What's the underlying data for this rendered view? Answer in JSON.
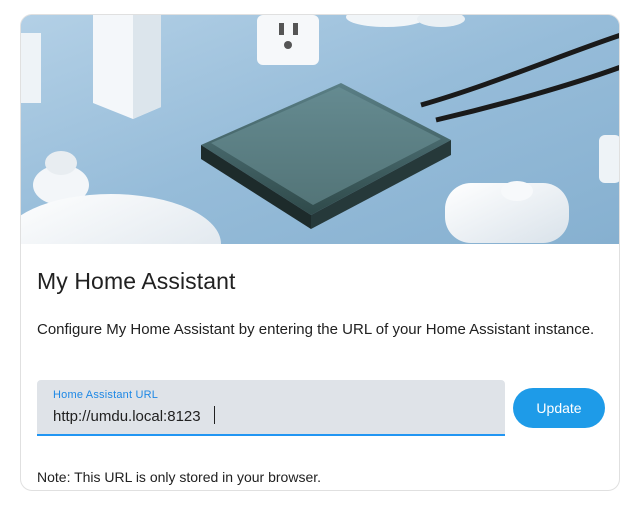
{
  "card": {
    "hero_image": "home-assistant-hardware-photo",
    "title": "My Home Assistant",
    "description": "Configure My Home Assistant by entering the URL of your Home Assistant instance.",
    "url_field": {
      "label": "Home Assistant URL",
      "value": "http://umdu.local:8123"
    },
    "update_label": "Update",
    "note": "Note: This URL is only stored in your browser."
  },
  "colors": {
    "accent": "#1e9be8",
    "field_bg": "#dfe3e8",
    "field_underline": "#2196f3"
  }
}
